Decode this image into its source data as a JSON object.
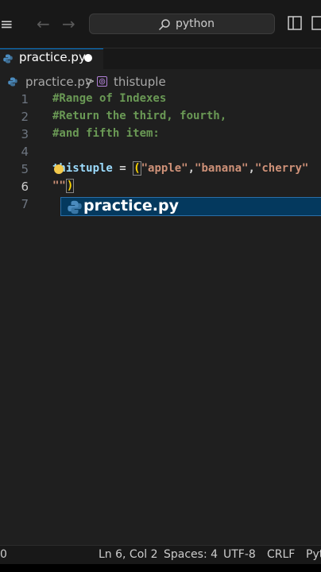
{
  "titlebar": {
    "search_text": "python"
  },
  "tab": {
    "label": "practice.py"
  },
  "breadcrumb": {
    "file": "practice.py",
    "separator": ">",
    "symbol": "thistuple"
  },
  "editor": {
    "line_numbers": [
      "1",
      "2",
      "3",
      "4",
      "5",
      "6",
      "7"
    ],
    "line1": "#Range of Indexes",
    "line2": "#Return the third, fourth,",
    "line3": "#and fifth item:",
    "line5": {
      "var": "thistuple",
      "op": " = ",
      "paren": "(",
      "s1": "\"apple\"",
      "s2": "\"banana\"",
      "s3": "\"cherry\"",
      "comma": ","
    },
    "line6": {
      "str": "\"\"",
      "paren": ")"
    }
  },
  "suggestion": {
    "label": "practice.py"
  },
  "statusbar": {
    "left": "0",
    "position": "Ln 6, Col 2",
    "spaces": "Spaces: 4",
    "encoding": "UTF-8",
    "eol": "CRLF",
    "language": "Pyt"
  },
  "colors": {
    "background": "#1f1f1f",
    "comment": "#6a9955",
    "string": "#ce9178",
    "variable": "#9cdcfe",
    "bracket": "#ffd700",
    "suggestion_bg": "#04395e"
  }
}
